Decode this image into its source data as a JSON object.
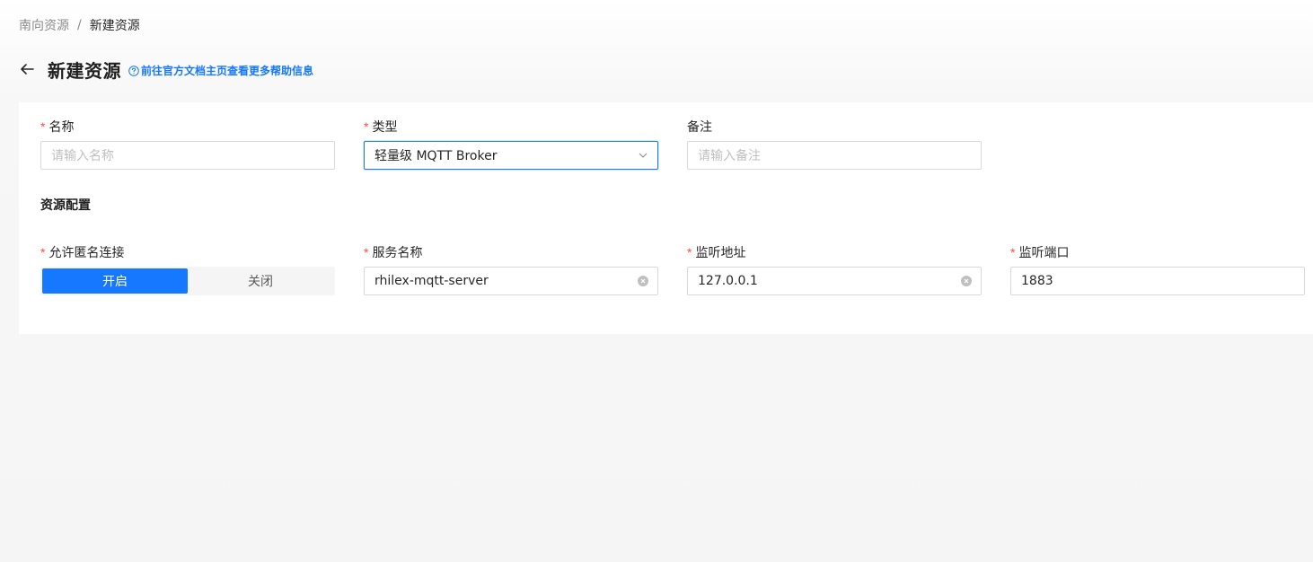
{
  "breadcrumb": {
    "parent": "南向资源",
    "separator": "/",
    "current": "新建资源"
  },
  "header": {
    "title": "新建资源",
    "help_link": "前往官方文档主页查看更多帮助信息"
  },
  "form": {
    "name": {
      "label": "名称",
      "required_mark": "*",
      "placeholder": "请输入名称"
    },
    "type": {
      "label": "类型",
      "required_mark": "*",
      "value": "轻量级 MQTT Broker"
    },
    "remark": {
      "label": "备注",
      "placeholder": "请输入备注"
    },
    "section_title": "资源配置",
    "anonymous": {
      "label": "允许匿名连接",
      "required_mark": "*",
      "options": [
        "开启",
        "关闭"
      ],
      "selected": "开启"
    },
    "service_name": {
      "label": "服务名称",
      "required_mark": "*",
      "value": "rhilex-mqtt-server"
    },
    "listen_address": {
      "label": "监听地址",
      "required_mark": "*",
      "value": "127.0.0.1"
    },
    "listen_port": {
      "label": "监听端口",
      "required_mark": "*",
      "value": "1883"
    }
  },
  "icons": {
    "back": "arrow-left-icon",
    "help": "question-circle-icon",
    "dropdown": "chevron-down-icon",
    "clear": "close-circle-icon"
  },
  "colors": {
    "primary": "#1677ff",
    "required": "#ff4d4f",
    "placeholder": "#bfbfbf"
  }
}
